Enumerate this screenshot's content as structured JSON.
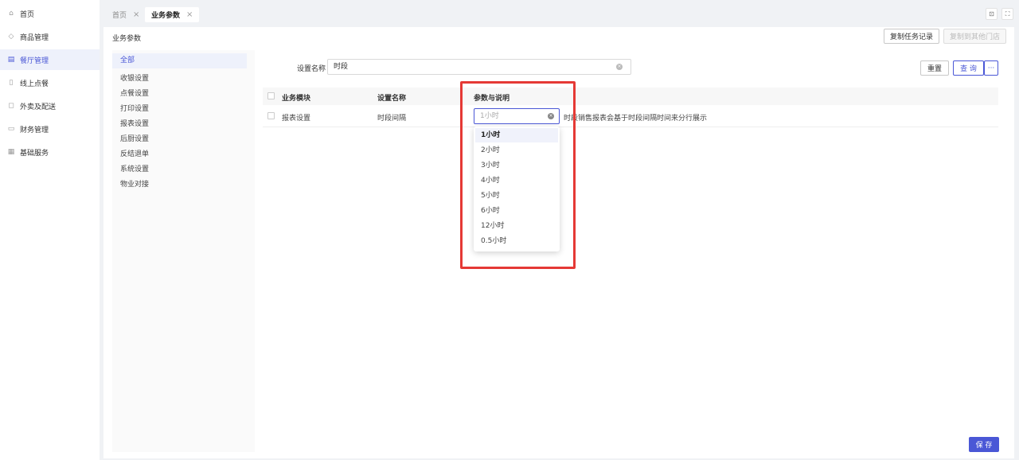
{
  "sidebar": {
    "items": [
      {
        "label": "首页",
        "icon": "home-icon",
        "glyph": "⌂"
      },
      {
        "label": "商品管理",
        "icon": "box-icon",
        "glyph": "◇"
      },
      {
        "label": "餐厅管理",
        "icon": "store-icon",
        "glyph": "▤"
      },
      {
        "label": "线上点餐",
        "icon": "online-order-icon",
        "glyph": "▯"
      },
      {
        "label": "外卖及配送",
        "icon": "delivery-icon",
        "glyph": "◻"
      },
      {
        "label": "财务管理",
        "icon": "finance-icon",
        "glyph": "▭"
      },
      {
        "label": "基础服务",
        "icon": "grid-icon",
        "glyph": "▦"
      }
    ],
    "active_index": 2
  },
  "tabs": [
    {
      "label": "首页",
      "close": "×"
    },
    {
      "label": "业务参数",
      "close": "×"
    }
  ],
  "top_icons": {
    "lock": "⊡",
    "fullscreen": "⛶"
  },
  "page": {
    "title": "业务参数",
    "copy_log_button": "复制任务记录",
    "copy_store_button": "复制到其他门店"
  },
  "categories": [
    "全部",
    "收银设置",
    "点餐设置",
    "打印设置",
    "报表设置",
    "后厨设置",
    "反结退单",
    "系统设置",
    "物业对接"
  ],
  "search": {
    "label": "设置名称",
    "value": "时段",
    "reset_button": "重置",
    "query_button": "查 询",
    "more_button": "···"
  },
  "table": {
    "headers": [
      "业务模块",
      "设置名称",
      "参数与说明"
    ],
    "rows": [
      {
        "module": "报表设置",
        "name": "时段间隔",
        "value": "1小时",
        "description": "时段销售报表会基于时段间隔时间来分行展示"
      }
    ]
  },
  "dropdown": {
    "options": [
      "1小时",
      "2小时",
      "3小时",
      "4小时",
      "5小时",
      "6小时",
      "12小时",
      "0.5小时"
    ],
    "selected_index": 0
  },
  "save_button": "保 存",
  "colors": {
    "primary": "#4a57d6",
    "highlight": "#e53935"
  }
}
